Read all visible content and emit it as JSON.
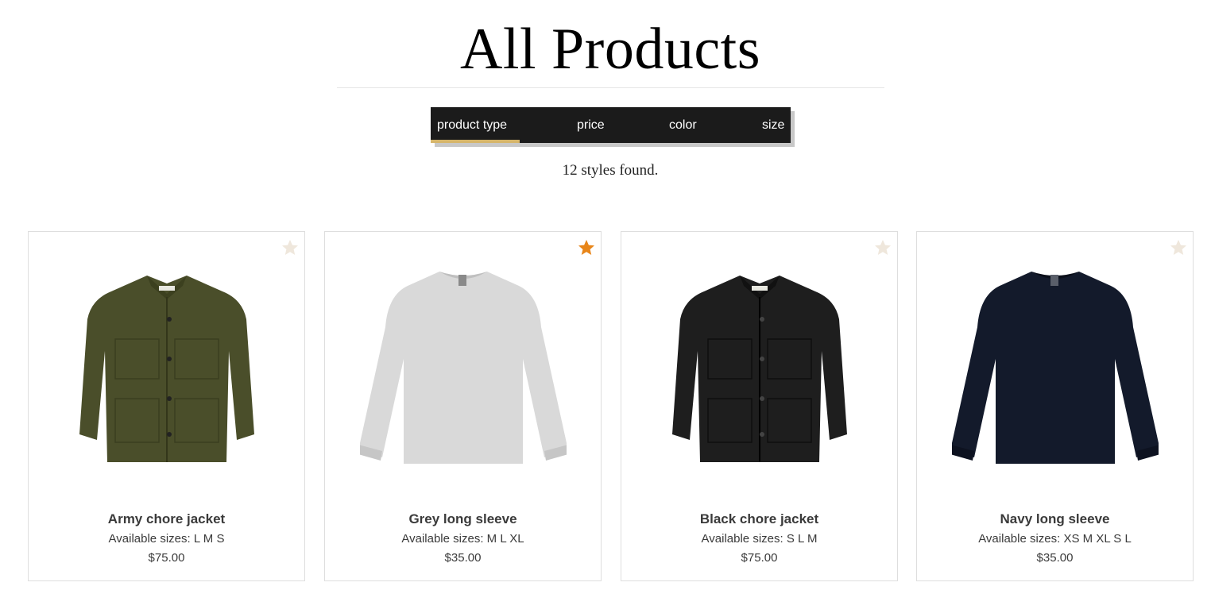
{
  "header": {
    "title": "All Products"
  },
  "filters": {
    "tabs": [
      {
        "label": "product type",
        "active": true
      },
      {
        "label": "price",
        "active": false
      },
      {
        "label": "color",
        "active": false
      },
      {
        "label": "size",
        "active": false
      }
    ],
    "active_underline_color": "#d6b56a",
    "bar_color": "#1b1b1b"
  },
  "results": {
    "count_text": "12 styles found."
  },
  "products": [
    {
      "name": "Army chore jacket",
      "sizes": "Available sizes: L M S",
      "price": "$75.00",
      "favorite": false,
      "image": "jacket-icon",
      "color": "#4a4e2a"
    },
    {
      "name": "Grey long sleeve",
      "sizes": "Available sizes: M L XL",
      "price": "$35.00",
      "favorite": true,
      "image": "long-sleeve-icon",
      "color": "#d9d9d9"
    },
    {
      "name": "Black chore jacket",
      "sizes": "Available sizes: S L M",
      "price": "$75.00",
      "favorite": false,
      "image": "jacket-icon",
      "color": "#1e1e1e"
    },
    {
      "name": "Navy long sleeve",
      "sizes": "Available sizes: XS M XL S L",
      "price": "$35.00",
      "favorite": false,
      "image": "long-sleeve-icon",
      "color": "#131a2b"
    }
  ],
  "colors": {
    "star_active": "#e8861a",
    "star_inactive": "#efe7dc"
  }
}
